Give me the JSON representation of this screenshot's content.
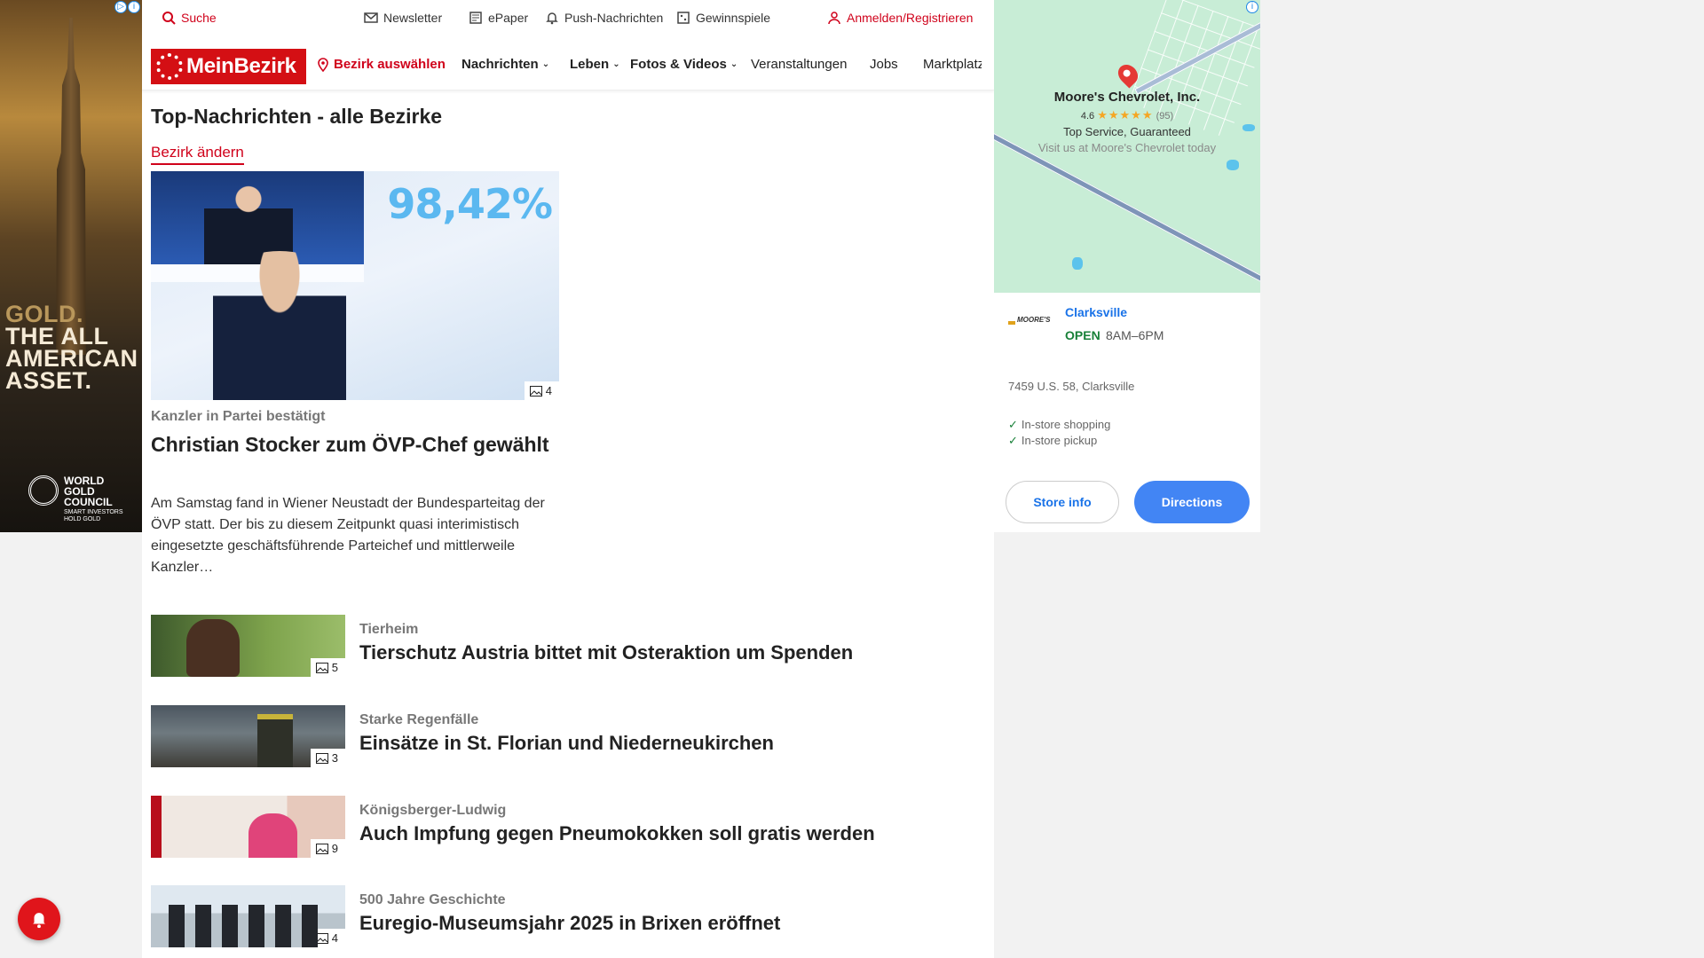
{
  "left_ad": {
    "line1": "GOLD.",
    "line2": "THE ALL",
    "line3": "AMERICAN",
    "line4": "ASSET.",
    "brand1": "WORLD",
    "brand2": "GOLD",
    "brand3": "COUNCIL",
    "tagline1": "SMART INVESTORS",
    "tagline2": "HOLD GOLD"
  },
  "topbar": {
    "search": "Suche",
    "newsletter": "Newsletter",
    "epaper": "ePaper",
    "push": "Push-Nachrichten",
    "gewinnspiele": "Gewinnspiele",
    "login": "Anmelden/Registrieren"
  },
  "nav": {
    "logo": "MeinBezirk",
    "select_district": "Bezirk auswählen",
    "items": [
      "Nachrichten",
      "Leben",
      "Fotos & Videos",
      "Veranstaltungen",
      "Jobs",
      "Marktplatz"
    ]
  },
  "section": {
    "title": "Top-Nachrichten - alle Bezirke",
    "change_link": "Bezirk ändern"
  },
  "featured": {
    "image_overlay": "98,42%",
    "image_count": "4",
    "kicker": "Kanzler in Partei bestätigt",
    "title": "Christian Stocker zum ÖVP-Chef gewählt",
    "teaser": "Am Samstag fand in Wiener Neustadt der Bundesparteitag der ÖVP statt. Der bis zu diesem Zeitpunkt quasi interimistisch eingesetzte geschäftsführende Parteichef und mittlerweile Kanzler…"
  },
  "articles": [
    {
      "kicker": "Tierheim",
      "title": "Tierschutz Austria bittet mit Osteraktion um Spenden",
      "image_count": "5"
    },
    {
      "kicker": "Starke Regenfälle",
      "title": "Einsätze in St. Florian und Niederneukirchen",
      "image_count": "3"
    },
    {
      "kicker": "Königsberger-Ludwig",
      "title": "Auch Impfung gegen Pneumokokken soll gratis werden",
      "image_count": "9"
    },
    {
      "kicker": "500 Jahre Geschichte",
      "title": "Euregio-Museumsjahr 2025 in Brixen eröffnet",
      "image_count": "4"
    }
  ],
  "right_ad": {
    "business_name": "Moore's Chevrolet, Inc.",
    "rating": "4.6",
    "stars": "★★★★★",
    "review_count": "(95)",
    "tagline": "Top Service, Guaranteed",
    "subline": "Visit us at Moore's Chevrolet today",
    "logo_text": "MOORE'S",
    "city": "Clarksville",
    "status": "OPEN",
    "hours": "8AM–6PM",
    "address": "7459 U.S. 58, Clarksville",
    "features": [
      "In-store shopping",
      "In-store pickup"
    ],
    "store_info_button": "Store info",
    "directions_button": "Directions"
  },
  "colors": {
    "brand_red": "#d40f14",
    "link_red": "#d0021b",
    "ad_blue": "#4285f4",
    "open_green": "#188038"
  }
}
